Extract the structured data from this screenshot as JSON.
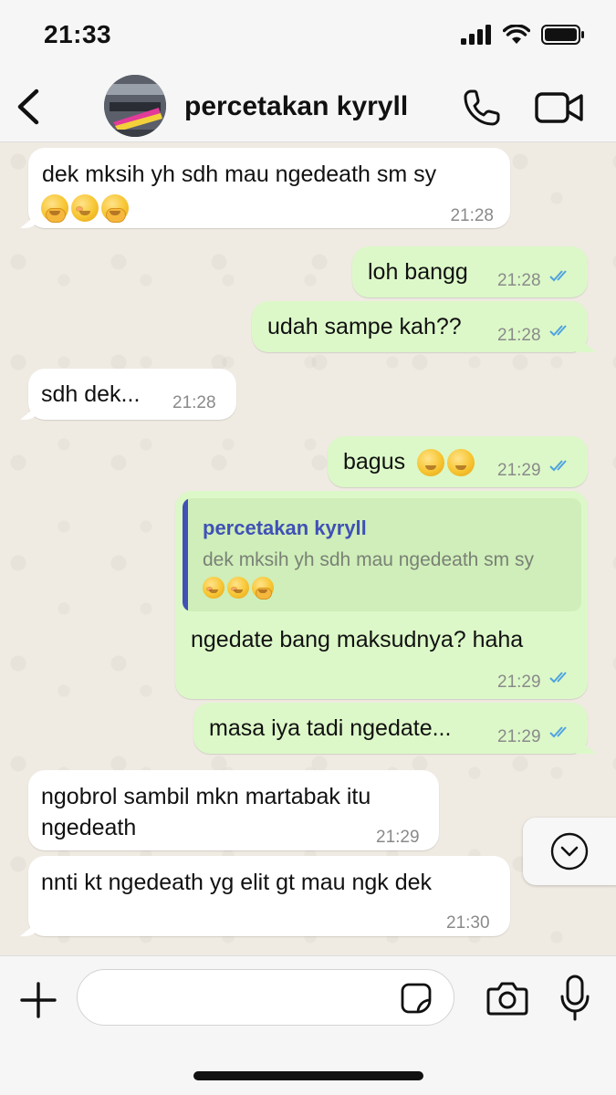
{
  "status_bar": {
    "time": "21:33",
    "icons": [
      "cellular-signal-icon",
      "wifi-icon",
      "battery-icon"
    ]
  },
  "header": {
    "back_icon": "chevron-left-icon",
    "contact_name": "percetakan kyryll",
    "call_icon": "phone-icon",
    "video_icon": "video-camera-icon"
  },
  "colors": {
    "incoming_bubble": "#ffffff",
    "outgoing_bubble": "#dcf8c8",
    "read_ticks": "#4fa3e0",
    "quote_accent": "#3f51b5",
    "chat_background": "#efeae2"
  },
  "messages": [
    {
      "direction": "in",
      "text": "dek mksih yh sdh mau ngedeath sm sy",
      "emojis": [
        "face-with-hand-over-mouth",
        "face-with-hand-over-mouth",
        "face-with-open-eyes-and-hand-over-mouth"
      ],
      "time": "21:28"
    },
    {
      "direction": "out",
      "text": "loh bangg",
      "time": "21:28",
      "status": "read"
    },
    {
      "direction": "out",
      "text": "udah sampe kah??",
      "time": "21:28",
      "status": "read"
    },
    {
      "direction": "in",
      "text": "sdh dek...",
      "time": "21:28"
    },
    {
      "direction": "out",
      "text": "bagus",
      "emojis": [
        "pensive-face",
        "pensive-face"
      ],
      "time": "21:29",
      "status": "read"
    },
    {
      "direction": "out",
      "reply_to": {
        "name": "percetakan kyryll",
        "text": "dek mksih yh sdh mau ngedeath sm sy",
        "emojis": [
          "face-with-hand-over-mouth",
          "face-with-hand-over-mouth",
          "face-with-open-eyes-and-hand-over-mouth"
        ]
      },
      "text": "ngedate bang maksudnya? haha",
      "time": "21:29",
      "status": "read"
    },
    {
      "direction": "out",
      "text": "masa iya tadi ngedate...",
      "time": "21:29",
      "status": "read"
    },
    {
      "direction": "in",
      "text_line1": "ngobrol sambil mkn martabak itu",
      "text_line2": "ngedeath",
      "time": "21:29"
    },
    {
      "direction": "in",
      "text": "nnti kt ngedeath yg elit gt mau ngk dek",
      "time": "21:30"
    }
  ],
  "scroll_down_icon": "chevron-down-circle-icon",
  "input_bar": {
    "plus_icon": "plus-icon",
    "placeholder": "",
    "value": "",
    "sticker_icon": "sticker-icon",
    "camera_icon": "camera-icon",
    "mic_icon": "microphone-icon"
  }
}
